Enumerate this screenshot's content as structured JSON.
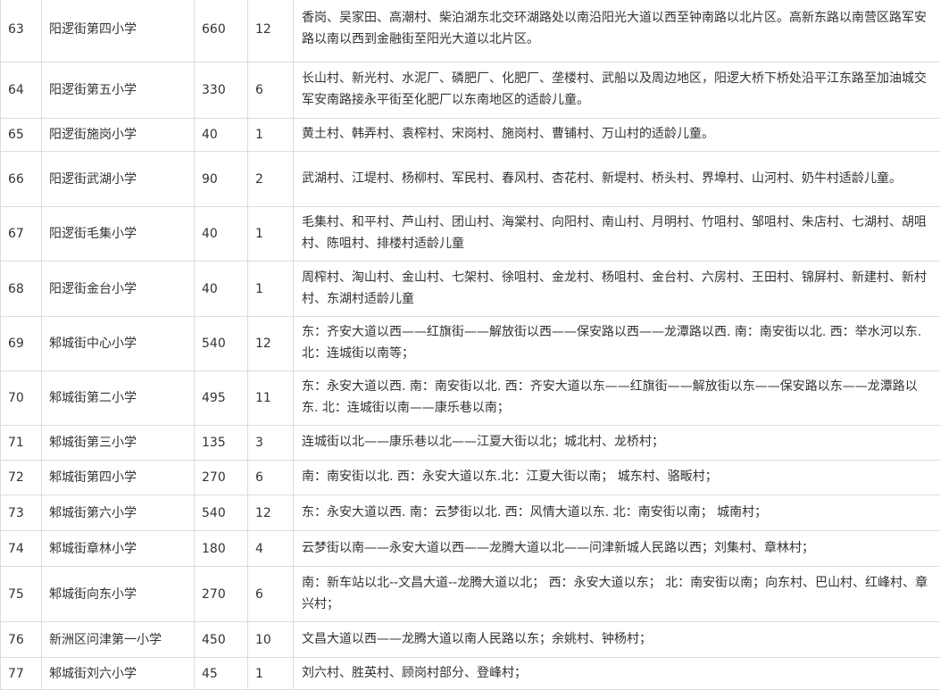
{
  "rows": [
    {
      "no": "63",
      "school": "阳逻街第四小学",
      "students": "660",
      "classes": "12",
      "area": "香岗、吴家田、高潮村、柴泊湖东北交环湖路处以南沿阳光大道以西至钟南路以北片区。高新东路以南营区路军安路以南以西到金融街至阳光大道以北片区。"
    },
    {
      "no": "64",
      "school": "阳逻街第五小学",
      "students": "330",
      "classes": "6",
      "area": "长山村、新光村、水泥厂、磷肥厂、化肥厂、垄楼村、武船以及周边地区，阳逻大桥下桥处沿平江东路至加油城交军安南路接永平街至化肥厂以东南地区的适龄儿童。"
    },
    {
      "no": "65",
      "school": "阳逻街施岗小学",
      "students": "40",
      "classes": "1",
      "area": "黄土村、韩弄村、袁榨村、宋岗村、施岗村、曹铺村、万山村的适龄儿童。"
    },
    {
      "no": "66",
      "school": "阳逻街武湖小学",
      "students": "90",
      "classes": "2",
      "area": "武湖村、江堤村、杨柳村、军民村、春风村、杏花村、新堤村、桥头村、界埠村、山河村、奶牛村适龄儿童。"
    },
    {
      "no": "67",
      "school": "阳逻街毛集小学",
      "students": "40",
      "classes": "1",
      "area": "毛集村、和平村、芦山村、团山村、海棠村、向阳村、南山村、月明村、竹咀村、邹咀村、朱店村、七湖村、胡咀村、陈咀村、排楼村适龄儿童"
    },
    {
      "no": "68",
      "school": "阳逻街金台小学",
      "students": "40",
      "classes": "1",
      "area": "周榨村、淘山村、金山村、七架村、徐咀村、金龙村、杨咀村、金台村、六房村、王田村、锦屏村、新建村、新村村、东湖村适龄儿童"
    },
    {
      "no": "69",
      "school": "邾城街中心小学",
      "students": "540",
      "classes": "12",
      "area": "东：齐安大道以西——红旗街——解放街以西——保安路以西——龙潭路以西.   南：南安街以北.    西：举水河以东.     北：连城街以南等；"
    },
    {
      "no": "70",
      "school": "邾城街第二小学",
      "students": "495",
      "classes": "11",
      "area": "东：永安大道以西.       南：南安街以北.    西：齐安大道以东——红旗街——解放街以东——保安路以东——龙潭路以东.     北：连城街以南——康乐巷以南；"
    },
    {
      "no": "71",
      "school": "邾城街第三小学",
      "students": "135",
      "classes": "3",
      "area": "连城街以北——康乐巷以北——江夏大街以北；城北村、龙桥村；"
    },
    {
      "no": "72",
      "school": "邾城街第四小学",
      "students": "270",
      "classes": "6",
      "area": "南：南安街以北.    西：永安大道以东.北：江夏大街以南；  城东村、骆畈村；"
    },
    {
      "no": "73",
      "school": "邾城街第六小学",
      "students": "540",
      "classes": "12",
      "area": "东：永安大道以西.    南：云梦街以北. 西：风情大道以东. 北：南安街以南；  城南村；"
    },
    {
      "no": "74",
      "school": "邾城街章林小学",
      "students": "180",
      "classes": "4",
      "area": "云梦街以南——永安大道以西——龙腾大道以北——问津新城人民路以西；刘集村、章林村；"
    },
    {
      "no": "75",
      "school": "邾城街向东小学",
      "students": "270",
      "classes": "6",
      "area": "南：新车站以北--文昌大道--龙腾大道以北；      西：永安大道以东；       北：南安街以南；向东村、巴山村、红峰村、章兴村；"
    },
    {
      "no": "76",
      "school": "新洲区问津第一小学",
      "students": "450",
      "classes": "10",
      "area": "文昌大道以西——龙腾大道以南人民路以东；余姚村、钟杨村；"
    },
    {
      "no": "77",
      "school": "邾城街刘六小学",
      "students": "45",
      "classes": "1",
      "area": "刘六村、胜英村、顾岗村部分、登峰村；"
    }
  ]
}
